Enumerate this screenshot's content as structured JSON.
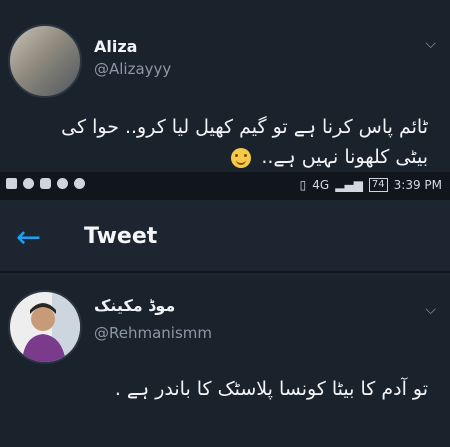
{
  "tweet1": {
    "name": "Aliza",
    "handle": "@Alizayyy",
    "text_line1": "ٹائم پاس کرنا ہے تو گیم کھیل لیا کرو.. حوا کی",
    "text_line2": "بیٹی کلھونا نہیں ہے..",
    "emoji": "smiling-face"
  },
  "status_bar": {
    "network": "4G",
    "battery": "74",
    "time": "3:39 PM"
  },
  "header": {
    "title": "Tweet"
  },
  "tweet2": {
    "name": "موڈ مکینک",
    "handle": "@Rehmanismm",
    "text": "تو آدم کا بیٹا کونسا پلاسٹک کا باندر ہے ."
  },
  "colors": {
    "accent": "#1da1f2",
    "background": "#151b24"
  }
}
